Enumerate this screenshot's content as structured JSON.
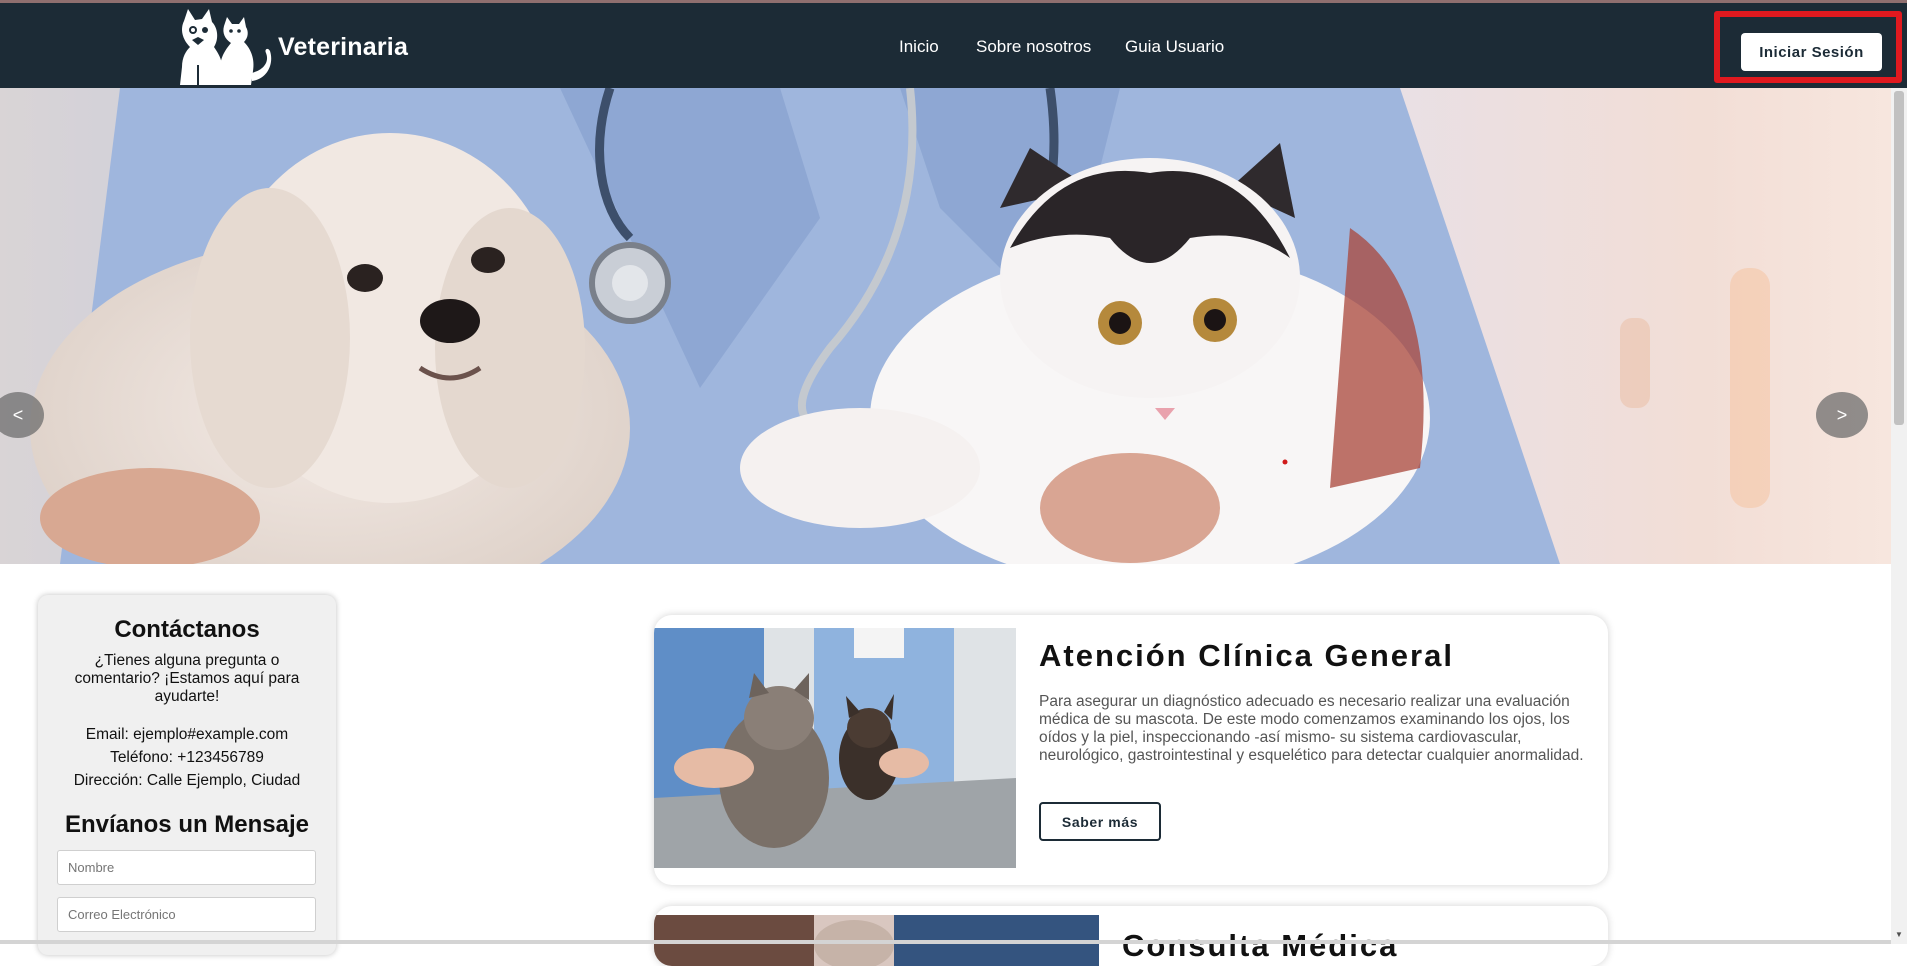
{
  "navbar": {
    "brand": "Veterinaria",
    "links": [
      "Inicio",
      "Sobre nosotros",
      "Guia Usuario"
    ],
    "login_label": "Iniciar Sesión",
    "background": "#1c2b36"
  },
  "hero": {
    "prev_label": "<",
    "next_label": ">"
  },
  "contact": {
    "title": "Contáctanos",
    "subtitle": "¿Tienes alguna pregunta o comentario? ¡Estamos aquí para ayudarte!",
    "email": "Email: ejemplo#example.com",
    "phone": "Teléfono: +123456789",
    "address": "Dirección: Calle Ejemplo, Ciudad",
    "form_title": "Envíanos un Mensaje",
    "name_placeholder": "Nombre",
    "email_placeholder": "Correo Electrónico"
  },
  "services": [
    {
      "title": "Atención Clínica General",
      "description": "Para asegurar un diagnóstico adecuado es necesario realizar una evaluación médica de su mascota. De este modo comenzamos examinando los ojos, los oídos y la piel, inspeccionando -así mismo- su sistema cardiovascular, neurológico, gastrointestinal y esquelético para detectar cualquier anormalidad.",
      "button_label": "Saber más"
    },
    {
      "title": "Consulta Médica"
    }
  ],
  "colors": {
    "highlight": "#e0191f",
    "navbar": "#1c2b36"
  }
}
